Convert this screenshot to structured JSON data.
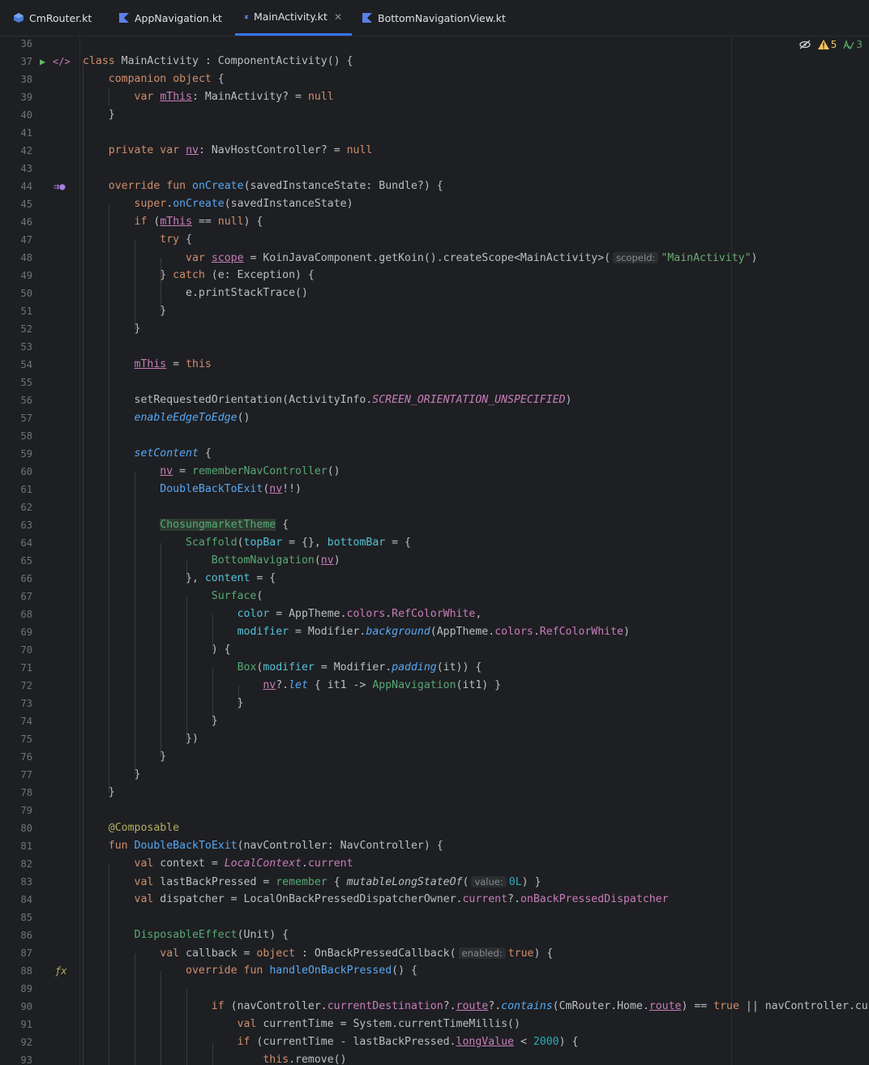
{
  "tabs": [
    {
      "label": "CmRouter.kt",
      "icon": "kotlin-object-icon"
    },
    {
      "label": "AppNavigation.kt",
      "icon": "kotlin-file-icon"
    },
    {
      "label": "MainActivity.kt",
      "icon": "kotlin-file-icon",
      "active": true
    },
    {
      "label": "BottomNavigationView.kt",
      "icon": "kotlin-file-icon"
    }
  ],
  "inspections": {
    "warnings": "5",
    "typos": "3"
  },
  "line_numbers": [
    "36",
    "37",
    "38",
    "39",
    "40",
    "41",
    "42",
    "43",
    "44",
    "45",
    "46",
    "47",
    "48",
    "49",
    "50",
    "51",
    "52",
    "53",
    "54",
    "55",
    "56",
    "57",
    "58",
    "59",
    "60",
    "61",
    "62",
    "63",
    "64",
    "65",
    "66",
    "67",
    "68",
    "69",
    "70",
    "71",
    "72",
    "73",
    "74",
    "75",
    "76",
    "77",
    "78",
    "79",
    "80",
    "81",
    "82",
    "83",
    "84",
    "85",
    "86",
    "87",
    "88",
    "89",
    "90",
    "91",
    "92",
    "93"
  ],
  "code_lines": [
    "",
    "class MainActivity : ComponentActivity() {",
    "    companion object {",
    "        var mThis: MainActivity? = null",
    "    }",
    "",
    "    private var nv: NavHostController? = null",
    "",
    "    override fun onCreate(savedInstanceState: Bundle?) {",
    "        super.onCreate(savedInstanceState)",
    "        if (mThis == null) {",
    "            try {",
    "                var scope = KoinJavaComponent.getKoin().createScope<MainActivity>( scopeId: \"MainActivity\")",
    "            } catch (e: Exception) {",
    "                e.printStackTrace()",
    "            }",
    "        }",
    "",
    "        mThis = this",
    "",
    "        setRequestedOrientation(ActivityInfo.SCREEN_ORIENTATION_UNSPECIFIED)",
    "        enableEdgeToEdge()",
    "",
    "        setContent {",
    "            nv = rememberNavController()",
    "            DoubleBackToExit(nv!!)",
    "",
    "            ChosungmarketTheme {",
    "                Scaffold(topBar = {}, bottomBar = {",
    "                    BottomNavigation(nv)",
    "                }, content = {",
    "                    Surface(",
    "                        color = AppTheme.colors.RefColorWhite,",
    "                        modifier = Modifier.background(AppTheme.colors.RefColorWhite)",
    "                    ) {",
    "                        Box(modifier = Modifier.padding(it)) {",
    "                            nv?.let { it1 -> AppNavigation(it1) }",
    "                        }",
    "                    }",
    "                })",
    "            }",
    "        }",
    "    }",
    "",
    "    @Composable",
    "    fun DoubleBackToExit(navController: NavController) {",
    "        val context = LocalContext.current",
    "        val lastBackPressed = remember { mutableLongStateOf( value: 0L) }",
    "        val dispatcher = LocalOnBackPressedDispatcherOwner.current?.onBackPressedDispatcher",
    "",
    "        DisposableEffect(Unit) {",
    "            val callback = object : OnBackPressedCallback( enabled: true) {",
    "                override fun handleOnBackPressed() {",
    "",
    "                    if (navController.currentDestination?.route?.contains(CmRouter.Home.route) == true || navController.cu",
    "                        val currentTime = System.currentTimeMillis()",
    "                        if (currentTime - lastBackPressed.longValue < 2000) {",
    "                            this.remove()"
  ],
  "colors": {
    "background": "#1e1f22",
    "keyword": "#cf8e6d",
    "function": "#56a8f5",
    "string": "#6aab73",
    "number": "#2aacb8",
    "property": "#c77dbb",
    "composable": "#57aa75",
    "annotation": "#b3ae60",
    "tab_accent": "#3574f0",
    "warning": "#f2c55c",
    "typo": "#59a869"
  },
  "gutter_icons": {
    "run": "run-icon",
    "implements": "implements-icon",
    "override": "override-icon",
    "function": "function-icon"
  }
}
